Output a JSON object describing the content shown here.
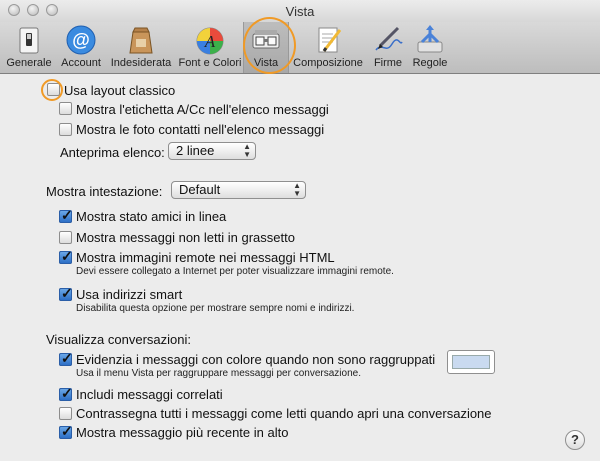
{
  "window": {
    "title": "Vista"
  },
  "toolbar": {
    "items": [
      {
        "label": "Generale",
        "icon": "switch-icon"
      },
      {
        "label": "Account",
        "icon": "at-sign-icon"
      },
      {
        "label": "Indesiderata",
        "icon": "junk-bag-icon"
      },
      {
        "label": "Font e Colori",
        "icon": "font-colors-icon"
      },
      {
        "label": "Vista",
        "icon": "viewing-glasses-icon",
        "selected": true
      },
      {
        "label": "Composizione",
        "icon": "compose-pen-icon"
      },
      {
        "label": "Firme",
        "icon": "signature-pen-icon"
      },
      {
        "label": "Regole",
        "icon": "rules-arrows-icon"
      }
    ]
  },
  "options": {
    "classic_layout": {
      "label": "Usa layout classico",
      "checked": false
    },
    "show_cc": {
      "label": "Mostra l'etichetta A/Cc nell'elenco messaggi",
      "checked": false
    },
    "show_photos": {
      "label": "Mostra le foto contatti nell'elenco messaggi",
      "checked": false
    },
    "preview_label": "Anteprima elenco:",
    "preview_value": "2 linee",
    "header_label": "Mostra intestazione:",
    "header_value": "Default",
    "buddy_status": {
      "label": "Mostra stato amici in linea",
      "checked": true
    },
    "unread_bold": {
      "label": "Mostra messaggi non letti in grassetto",
      "checked": false
    },
    "remote_images": {
      "label": "Mostra immagini remote nei messaggi HTML",
      "checked": true,
      "note": "Devi essere collegato a Internet per poter visualizzare immagini remote."
    },
    "smart_addresses": {
      "label": "Usa indirizzi smart",
      "checked": true,
      "note": "Disabilita questa opzione per mostrare sempre nomi e indirizzi."
    },
    "conversations_heading": "Visualizza conversazioni:",
    "highlight": {
      "label": "Evidenzia i messaggi con colore quando non sono raggruppati",
      "checked": true,
      "note": "Usa il menu Vista per raggruppare messaggi per conversazione.",
      "color": "#c9daf0"
    },
    "related": {
      "label": "Includi messaggi correlati",
      "checked": true
    },
    "mark_read": {
      "label": "Contrassegna tutti i messaggi come letti quando apri una conversazione",
      "checked": false
    },
    "newest_top": {
      "label": "Mostra messaggio più recente in alto",
      "checked": true
    }
  },
  "help": {
    "label": "?"
  },
  "accent": "#f09a26"
}
